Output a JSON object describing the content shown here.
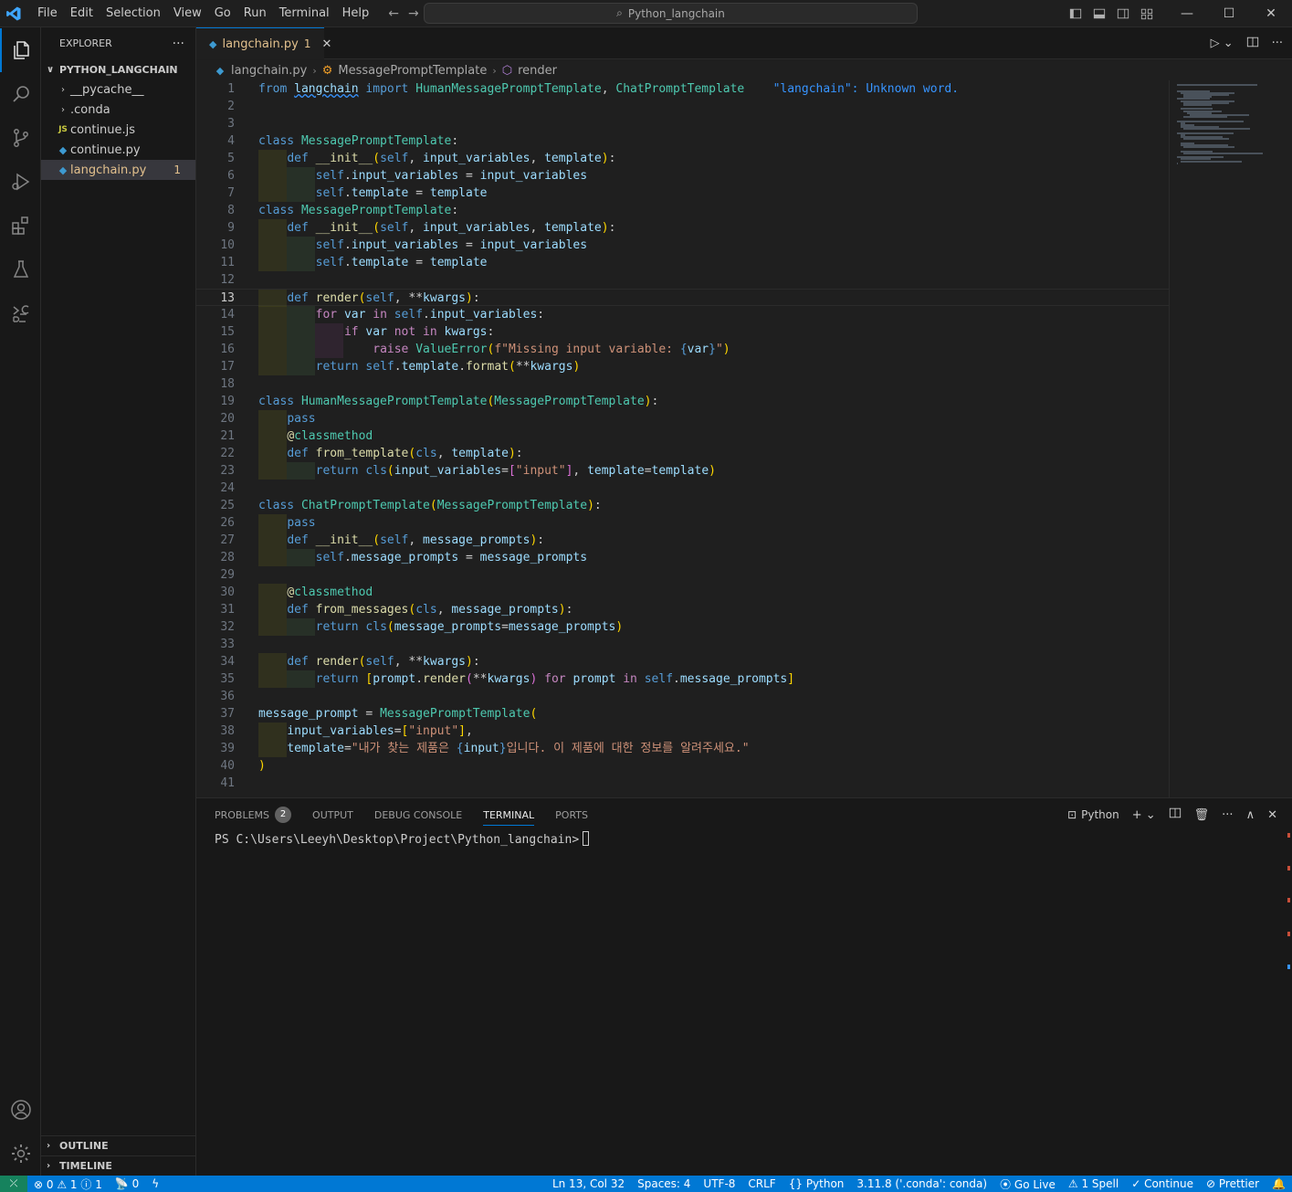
{
  "titlebar": {
    "menu": [
      "File",
      "Edit",
      "Selection",
      "View",
      "Go",
      "Run",
      "Terminal",
      "Help"
    ],
    "search_text": "Python_langchain"
  },
  "explorer": {
    "title": "EXPLORER",
    "more": "···",
    "workspace": "PYTHON_LANGCHAIN",
    "items": [
      {
        "name": "__pycache__",
        "type": "folder"
      },
      {
        "name": ".conda",
        "type": "folder"
      },
      {
        "name": "continue.js",
        "type": "js"
      },
      {
        "name": "continue.py",
        "type": "py"
      },
      {
        "name": "langchain.py",
        "type": "py",
        "badge": "1",
        "selected": true
      }
    ],
    "outline": "OUTLINE",
    "timeline": "TIMELINE"
  },
  "tab": {
    "name": "langchain.py",
    "count": "1"
  },
  "breadcrumb": [
    "langchain.py",
    "MessagePromptTemplate",
    "render"
  ],
  "editor": {
    "hint": "\"langchain\": Unknown word.",
    "line_numbers": [
      "1",
      "2",
      "3",
      "4",
      "5",
      "6",
      "7",
      "8",
      "9",
      "10",
      "11",
      "12",
      "13",
      "14",
      "15",
      "16",
      "17",
      "18",
      "19",
      "20",
      "21",
      "22",
      "23",
      "24",
      "25",
      "26",
      "27",
      "28",
      "29",
      "30",
      "31",
      "32",
      "33",
      "34",
      "35",
      "36",
      "37",
      "38",
      "39",
      "40",
      "41"
    ],
    "code": [
      "from langchain import HumanMessagePromptTemplate, ChatPromptTemplate",
      "",
      "",
      "class MessagePromptTemplate:",
      "    def __init__(self, input_variables, template):",
      "        self.input_variables = input_variables",
      "        self.template = template",
      "class MessagePromptTemplate:",
      "    def __init__(self, input_variables, template):",
      "        self.input_variables = input_variables",
      "        self.template = template",
      "",
      "    def render(self, **kwargs):",
      "        for var in self.input_variables:",
      "            if var not in kwargs:",
      "                raise ValueError(f\"Missing input variable: {var}\")",
      "        return self.template.format(**kwargs)",
      "",
      "class HumanMessagePromptTemplate(MessagePromptTemplate):",
      "    pass",
      "    @classmethod",
      "    def from_template(cls, template):",
      "        return cls(input_variables=[\"input\"], template=template)",
      "",
      "class ChatPromptTemplate(MessagePromptTemplate):",
      "    pass",
      "    def __init__(self, message_prompts):",
      "        self.message_prompts = message_prompts",
      "",
      "    @classmethod",
      "    def from_messages(cls, message_prompts):",
      "        return cls(message_prompts=message_prompts)",
      "",
      "    def render(self, **kwargs):",
      "        return [prompt.render(**kwargs) for prompt in self.message_prompts]",
      "",
      "message_prompt = MessagePromptTemplate(",
      "    input_variables=[\"input\"],",
      "    template=\"내가 찾는 제품은 {input}입니다. 이 제품에 대한 정보를 알려주세요.\"",
      ")",
      ""
    ]
  },
  "panel": {
    "tabs": [
      "PROBLEMS",
      "OUTPUT",
      "DEBUG CONSOLE",
      "TERMINAL",
      "PORTS"
    ],
    "problems_count": "2",
    "terminal_label": "Python",
    "prompt": "PS C:\\Users\\Leeyh\\Desktop\\Project\\Python_langchain>"
  },
  "statusbar": {
    "errors": "0",
    "warnings": "1",
    "infos": "1",
    "ports": "0",
    "position": "Ln 13, Col 32",
    "spaces": "Spaces: 4",
    "encoding": "UTF-8",
    "eol": "CRLF",
    "language": "Python",
    "interpreter": "3.11.8 ('.conda': conda)",
    "golive": "Go Live",
    "spell": "1 Spell",
    "continue": "Continue",
    "prettier": "Prettier"
  },
  "colors": {
    "accent": "#0078d4",
    "remote": "#16825d",
    "modified": "#e2c08d"
  }
}
